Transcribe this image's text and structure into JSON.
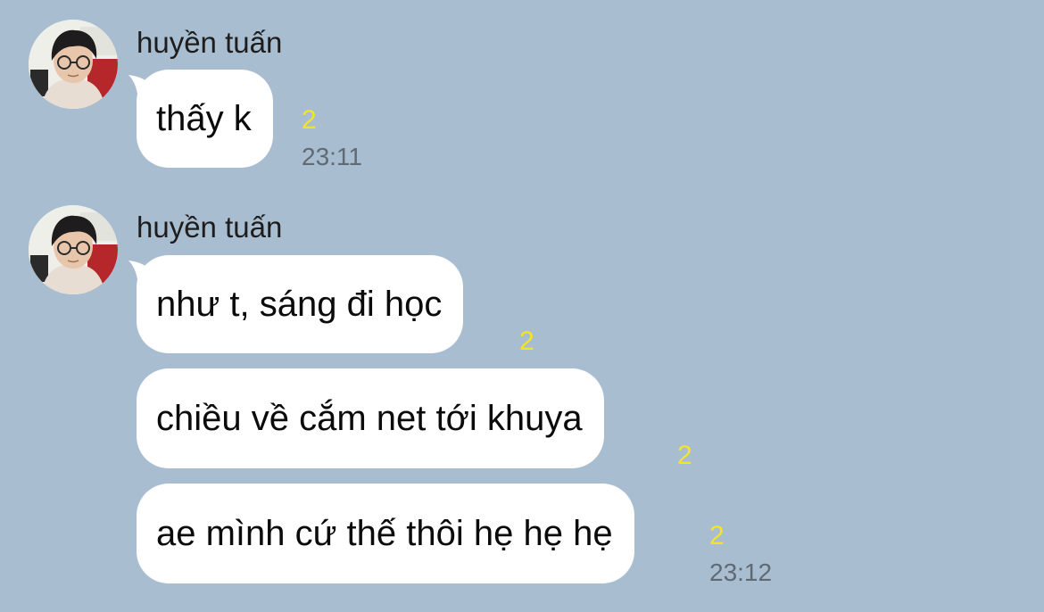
{
  "app": {
    "background": "#a9bdd1",
    "bubble_color": "#ffffff",
    "read_color": "#f5e32a"
  },
  "groups": [
    {
      "sender": "huyền tuấn",
      "avatar_icon": "user-photo",
      "messages": [
        {
          "text": "thấy k",
          "read_count": "2",
          "time": "23:11"
        }
      ]
    },
    {
      "sender": "huyền tuấn",
      "avatar_icon": "user-photo",
      "messages": [
        {
          "text": "như t, sáng đi học",
          "read_count": "2",
          "time": ""
        },
        {
          "text": "chiều về cắm net tới khuya",
          "read_count": "2",
          "time": ""
        },
        {
          "text": "ae mình cứ thế thôi hẹ hẹ hẹ",
          "read_count": "2",
          "time": "23:12"
        }
      ]
    }
  ]
}
